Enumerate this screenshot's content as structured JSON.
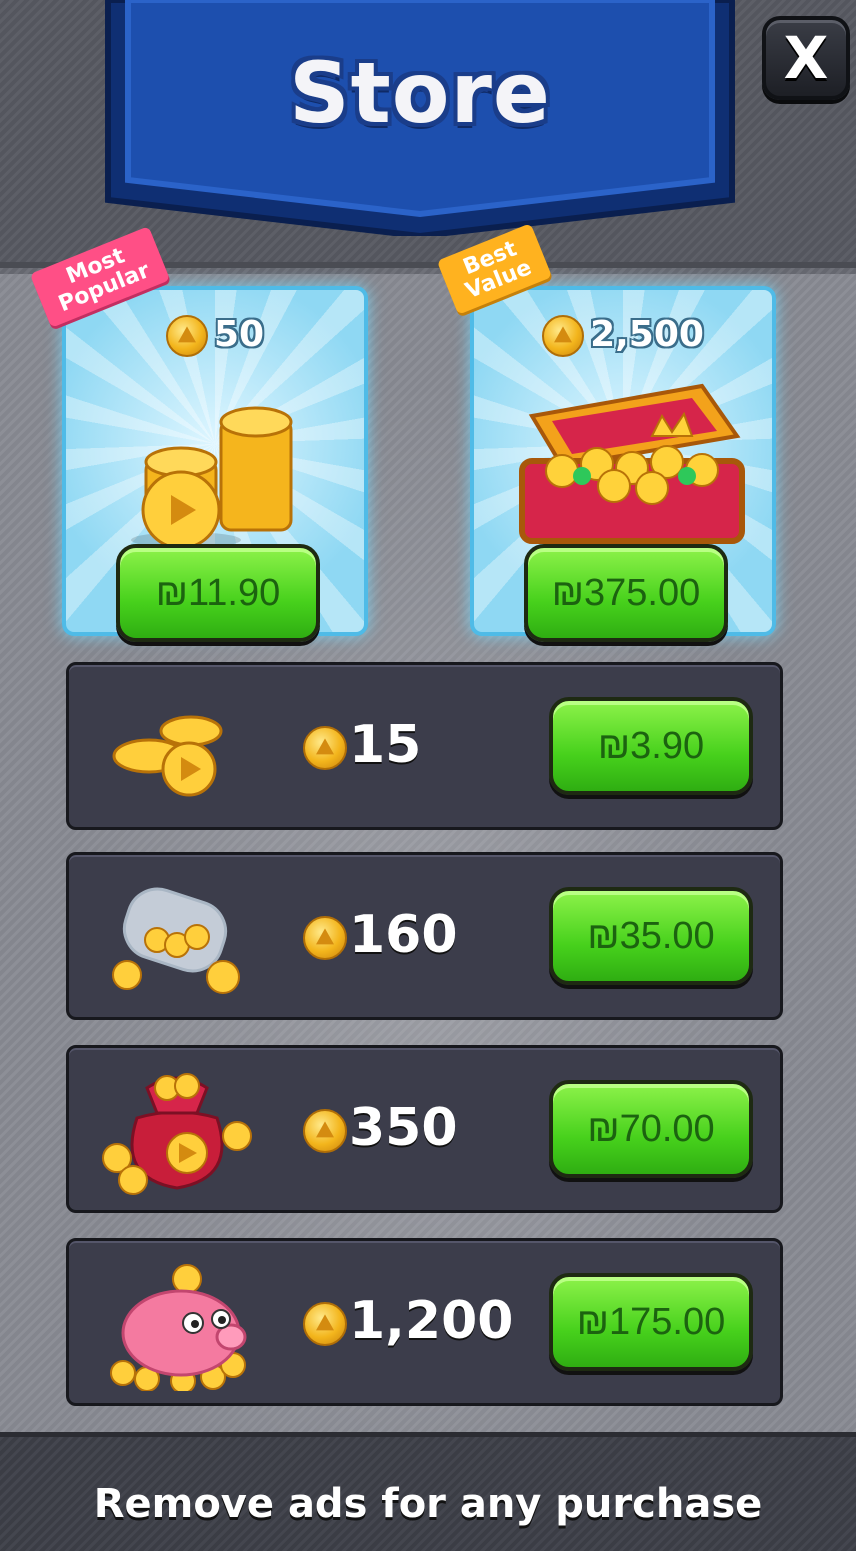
{
  "header": {
    "title": "Store",
    "close_label": "X"
  },
  "featured": [
    {
      "tag": "Most\nPopular",
      "tag_color": "#ff4f86",
      "amount": "50",
      "price": "₪11.90",
      "icon": "coin-stack-icon"
    },
    {
      "tag": "Best\nValue",
      "tag_color": "#ffb21f",
      "amount": "2,500",
      "price": "₪375.00",
      "icon": "treasure-chest-icon"
    }
  ],
  "packages": [
    {
      "amount": "15",
      "price": "₪3.90",
      "icon": "coin-pile-icon"
    },
    {
      "amount": "160",
      "price": "₪35.00",
      "icon": "coin-jar-icon"
    },
    {
      "amount": "350",
      "price": "₪70.00",
      "icon": "coin-sack-icon"
    },
    {
      "amount": "1,200",
      "price": "₪175.00",
      "icon": "piggy-bank-icon"
    }
  ],
  "footer": {
    "text": "Remove ads for any purchase"
  },
  "colors": {
    "buy_button": "#47d11c",
    "card_border": "#4fbbe7",
    "banner": "#1a3d8a"
  }
}
